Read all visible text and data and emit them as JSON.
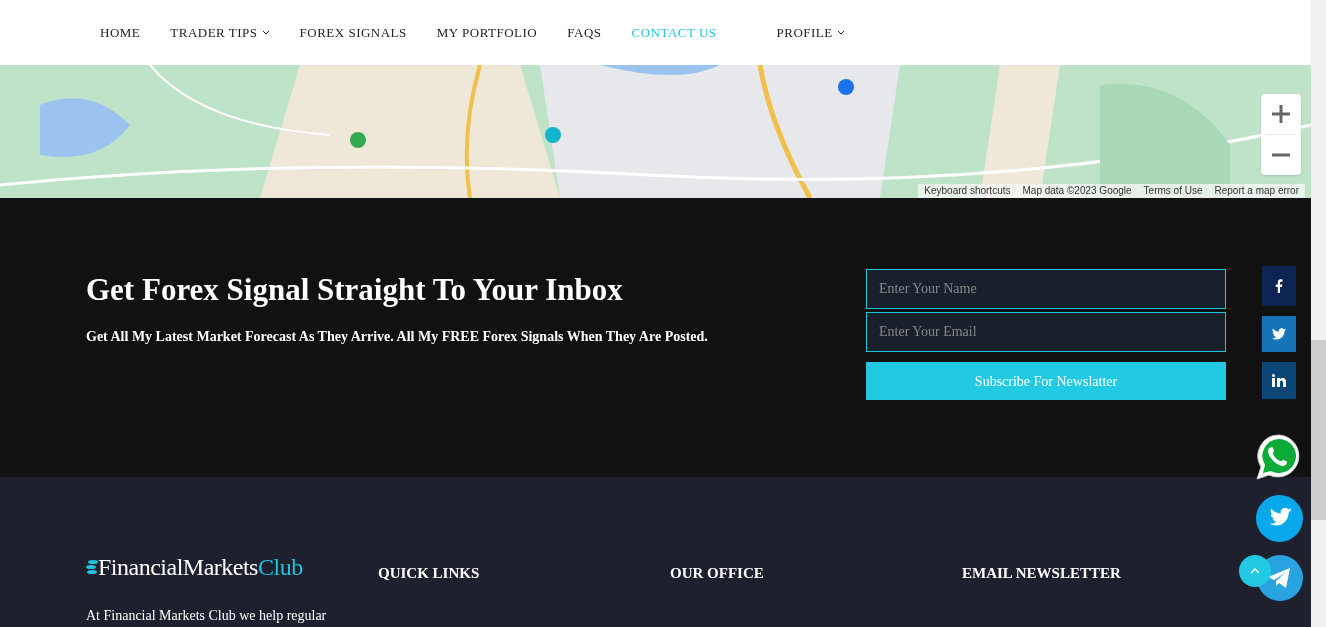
{
  "nav": {
    "items": [
      {
        "label": "HOME",
        "selected": false,
        "dropdown": false
      },
      {
        "label": "TRADER TIPS",
        "selected": false,
        "dropdown": true
      },
      {
        "label": "FOREX SIGNALS",
        "selected": false,
        "dropdown": false
      },
      {
        "label": "MY PORTFOLIO",
        "selected": false,
        "dropdown": false
      },
      {
        "label": "FAQS",
        "selected": false,
        "dropdown": false
      },
      {
        "label": "CONTACT US",
        "selected": true,
        "dropdown": false
      },
      {
        "label": "PROFILE",
        "selected": false,
        "dropdown": true
      }
    ]
  },
  "map": {
    "attribution": [
      "Keyboard shortcuts",
      "Map data ©2023 Google",
      "Terms of Use",
      "Report a map error"
    ]
  },
  "newsletter": {
    "title": "Get Forex Signal Straight To Your Inbox",
    "subtitle": "Get All My Latest Market Forecast As They Arrive. All My FREE Forex Signals When They Are Posted.",
    "name_placeholder": "Enter Your Name",
    "email_placeholder": "Enter Your Email",
    "button": "Subscribe For Newslatter"
  },
  "footer": {
    "logo": {
      "prefix": "FinancialMarkets",
      "suffix": "Club"
    },
    "about": "At Financial Markets Club we help regular",
    "headings": [
      "QUICK LINKS",
      "OUR OFFICE",
      "EMAIL NEWSLETTER"
    ]
  }
}
